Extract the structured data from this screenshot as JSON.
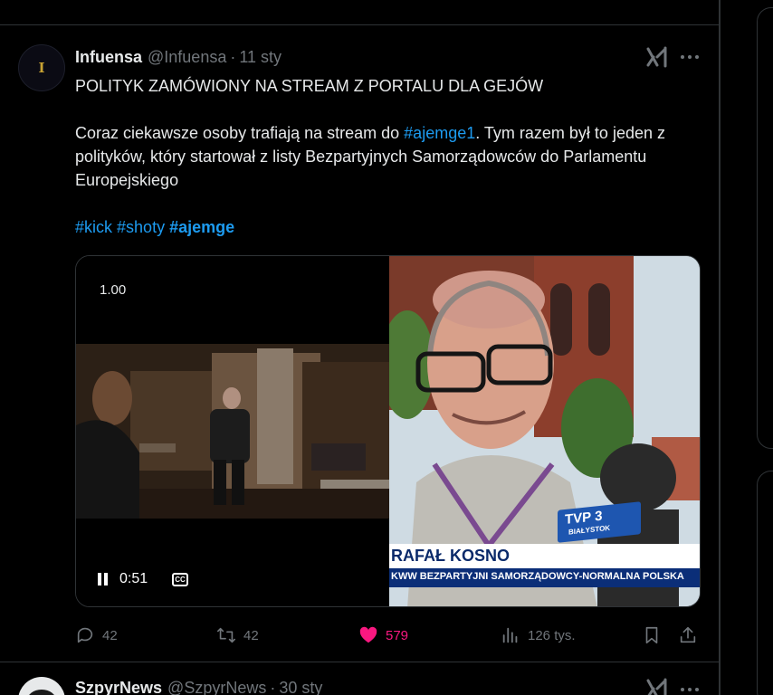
{
  "tweet": {
    "author_name": "Infuensa",
    "author_handle": "@Infuensa",
    "separator": "·",
    "time": "11 sty",
    "avatar_letter": "I",
    "text": {
      "line1": "POLITYK ZAMÓWIONY NA STREAM Z PORTALU DLA GEJÓW",
      "p2_before": "Coraz ciekawsze osoby trafiają na stream do ",
      "p2_hashtag": "#ajemge1",
      "p2_after": ". Tym razem był to jeden z polityków, który startował z listy Bezpartyjnych Samorządowców do Parlamentu Europejskiego",
      "hashtag1": "#kick",
      "hashtag2": "#shoty",
      "hashtag3": "#ajemge"
    },
    "video": {
      "speed": "1.00",
      "elapsed": "0:51",
      "cc_label": "CC",
      "lower_third_name": "RAFAŁ KOSNO",
      "lower_third_sub": "KWW BEZPARTYJNI SAMORZĄDOWCY-NORMALNA POLSKA",
      "tvp_logo": "TVP 3",
      "tvp_city": "BIAŁYSTOK"
    },
    "actions": {
      "replies": "42",
      "reposts": "42",
      "likes": "579",
      "views": "126 tys."
    },
    "colors": {
      "link": "#1d9bf0",
      "like_active": "#f91880",
      "muted": "#71767b"
    }
  },
  "next_tweet": {
    "author_name": "SzpyrNews",
    "author_handle": "@SzpyrNews",
    "separator": "·",
    "time": "30 sty"
  },
  "icons": [
    "grok-icon",
    "more-icon",
    "reply-icon",
    "retweet-icon",
    "heart-icon",
    "views-icon",
    "bookmark-icon",
    "share-icon",
    "pause-icon",
    "cc-icon"
  ]
}
